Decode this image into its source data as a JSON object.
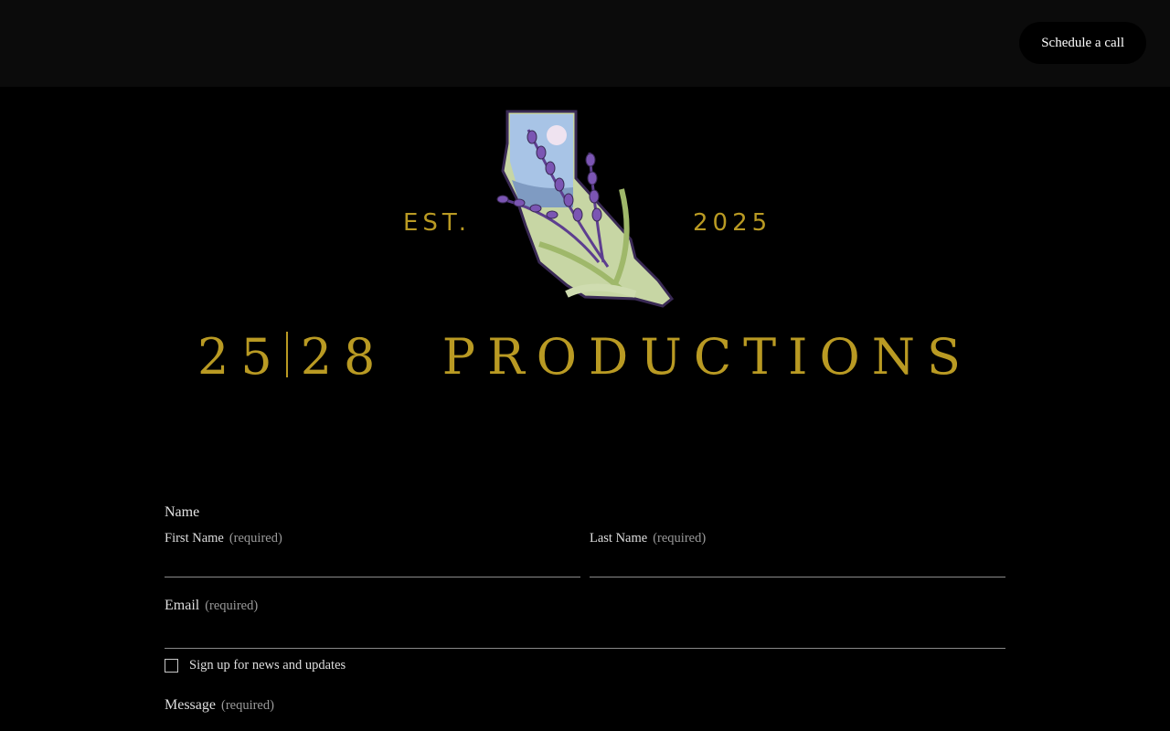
{
  "header": {
    "cta_label": "Schedule a call"
  },
  "logo": {
    "est_text": "EST.",
    "year_text": "2025",
    "brand_left": "25",
    "brand_mid": "28",
    "brand_right": "PRODUCTIONS"
  },
  "form": {
    "legend": "Name",
    "first_name_label": "First Name",
    "last_name_label": "Last Name",
    "email_label": "Email",
    "message_label": "Message",
    "required_text": "(required)",
    "newsletter_label": "Sign up for news and updates",
    "first_name_value": "",
    "last_name_value": "",
    "email_value": ""
  },
  "colors": {
    "brand_gold": "#b99a23",
    "lavender": "#6c4aa0",
    "sage": "#b8c79a"
  }
}
